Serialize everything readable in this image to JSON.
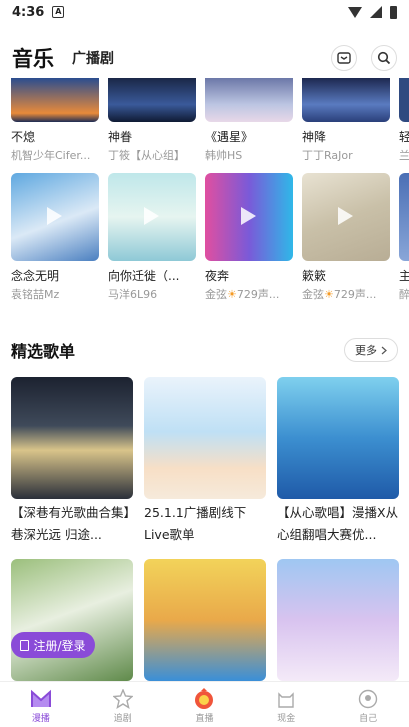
{
  "status_bar": {
    "time": "4:36",
    "notif_icon": "A"
  },
  "header": {
    "title": "音乐",
    "subtab": "广播剧"
  },
  "top_row": [
    {
      "name": "不熄",
      "artist": "机智少年Cifer..."
    },
    {
      "name": "神眷",
      "artist": "丁筱【从心组】"
    },
    {
      "name": "《遇星》",
      "artist": "韩帅HS"
    },
    {
      "name": "神降",
      "artist": "丁丁RaJor"
    },
    {
      "name": "轻",
      "artist": "兰"
    }
  ],
  "mid_row": [
    {
      "name": "念念无明",
      "artist": "袁铭喆Mz"
    },
    {
      "name": "向你迁徙（...",
      "artist": "马洋6L96"
    },
    {
      "name": "夜奔",
      "artist_pre": "金弦",
      "artist_post": "729声..."
    },
    {
      "name": "簌簌",
      "artist_pre": "金弦",
      "artist_post": "729声..."
    },
    {
      "name": "主",
      "artist": "醉"
    }
  ],
  "featured": {
    "title": "精选歌单",
    "more": "更多"
  },
  "playlists": [
    {
      "name": "【深巷有光歌曲合集】巷深光远 归途..."
    },
    {
      "name": "25.1.1广播剧线下Live歌单"
    },
    {
      "name": "【从心歌唱】漫播X从心组翻唱大赛优..."
    }
  ],
  "login": {
    "label": "注册/登录"
  },
  "nav": [
    {
      "label": "漫播",
      "active": true
    },
    {
      "label": "追剧"
    },
    {
      "label": "直播"
    },
    {
      "label": "现金"
    },
    {
      "label": "自己"
    }
  ],
  "colors": {
    "accent": "#8a4bd8",
    "sun": "#f59a23"
  }
}
